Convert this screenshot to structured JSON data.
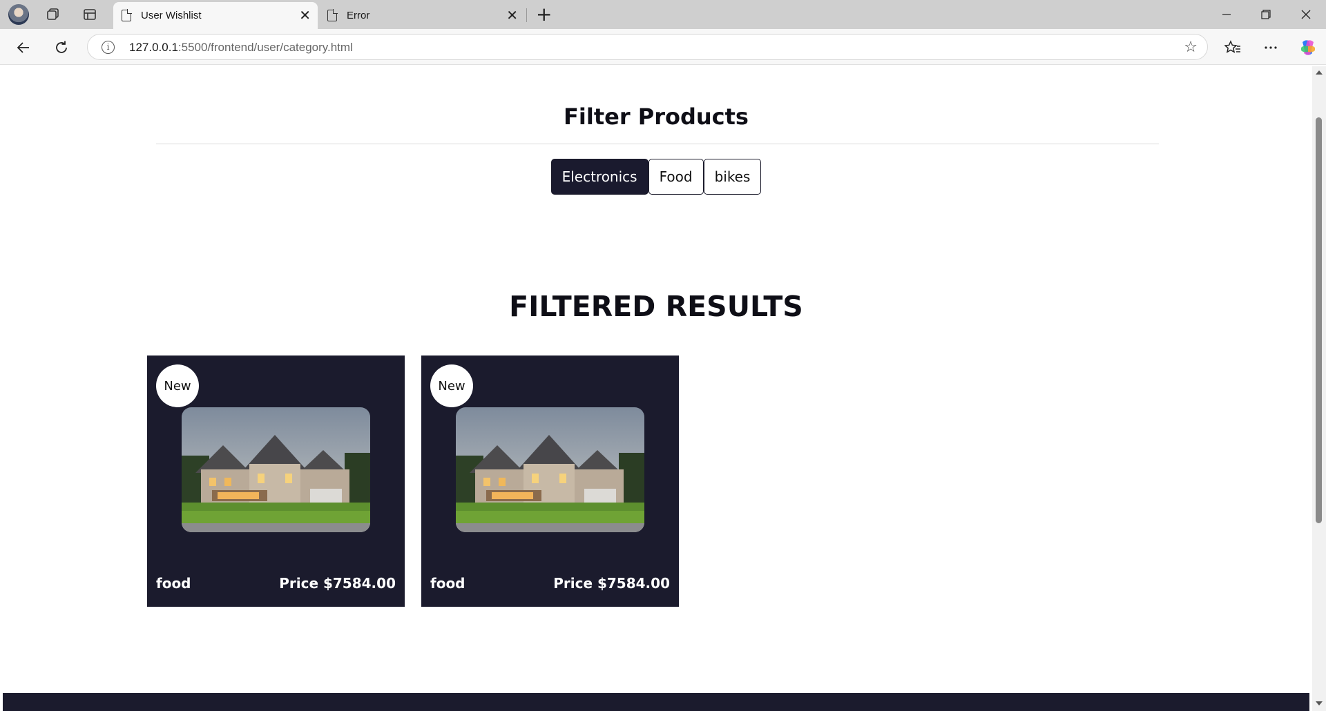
{
  "browser": {
    "tabs": [
      {
        "title": "User Wishlist",
        "active": true
      },
      {
        "title": "Error",
        "active": false
      }
    ],
    "address": {
      "host": "127.0.0.1",
      "path": ":5500/frontend/user/category.html"
    },
    "icons": {
      "avatar": "profile-avatar",
      "workspaces": "workspaces-icon",
      "tab_actions": "tab-actions-icon",
      "tab_page": "document-icon",
      "close": "close-icon",
      "new_tab": "plus-icon",
      "back": "back-arrow-icon",
      "reload": "reload-icon",
      "site_info": "info-icon",
      "favorite": "star-icon",
      "favorites": "favorites-icon",
      "more": "more-icon",
      "copilot": "copilot-icon"
    }
  },
  "page": {
    "filter_title": "Filter Products",
    "filters": [
      {
        "label": "Electronics",
        "active": true
      },
      {
        "label": "Food",
        "active": false
      },
      {
        "label": "bikes",
        "active": false
      }
    ],
    "results_title": "FILTERED RESULTS",
    "products": [
      {
        "badge": "New",
        "name": "food",
        "price": "Price $7584.00"
      },
      {
        "badge": "New",
        "name": "food",
        "price": "Price $7584.00"
      }
    ]
  },
  "colors": {
    "brand_dark": "#1b1b2d",
    "active_filter": "#1a1a2e",
    "chrome_bg": "#cfcfcf",
    "tab_active_bg": "#f7f7f7"
  }
}
